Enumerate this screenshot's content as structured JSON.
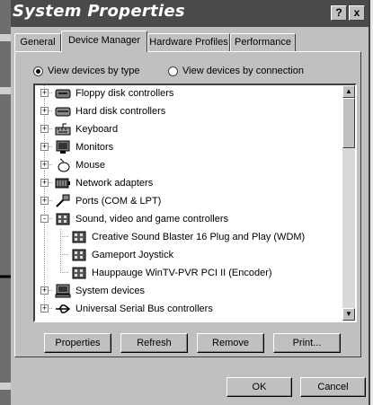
{
  "window": {
    "title": "System Properties"
  },
  "title_buttons": {
    "help": "?",
    "close": "x"
  },
  "tabs": [
    "General",
    "Device Manager",
    "Hardware Profiles",
    "Performance"
  ],
  "view": {
    "by_type": "View devices by type",
    "by_connection": "View devices by connection",
    "selected": "by_type"
  },
  "tree": [
    {
      "label": "Floppy disk controllers",
      "icon": "floppy-controller-icon",
      "expander": "+"
    },
    {
      "label": "Hard disk controllers",
      "icon": "disk-controller-icon",
      "expander": "+"
    },
    {
      "label": "Keyboard",
      "icon": "keyboard-icon",
      "expander": "+"
    },
    {
      "label": "Monitors",
      "icon": "monitor-icon",
      "expander": "+"
    },
    {
      "label": "Mouse",
      "icon": "mouse-icon",
      "expander": "+"
    },
    {
      "label": "Network adapters",
      "icon": "network-adapter-icon",
      "expander": "+"
    },
    {
      "label": "Ports (COM & LPT)",
      "icon": "port-icon",
      "expander": "+"
    },
    {
      "label": "Sound, video and game controllers",
      "icon": "multimedia-icon",
      "expander": "-"
    },
    {
      "label": "Creative Sound Blaster 16 Plug and Play (WDM)",
      "icon": "sound-card-icon"
    },
    {
      "label": "Gameport Joystick",
      "icon": "joystick-icon"
    },
    {
      "label": "Hauppauge WinTV-PVR PCI II (Encoder)",
      "icon": "tv-card-icon"
    },
    {
      "label": "System devices",
      "icon": "system-devices-icon",
      "expander": "+"
    },
    {
      "label": "Universal Serial Bus controllers",
      "icon": "usb-icon",
      "expander": "+"
    }
  ],
  "buttons": {
    "properties": "Properties",
    "refresh": "Refresh",
    "remove": "Remove",
    "print": "Print...",
    "ok": "OK",
    "cancel": "Cancel"
  }
}
